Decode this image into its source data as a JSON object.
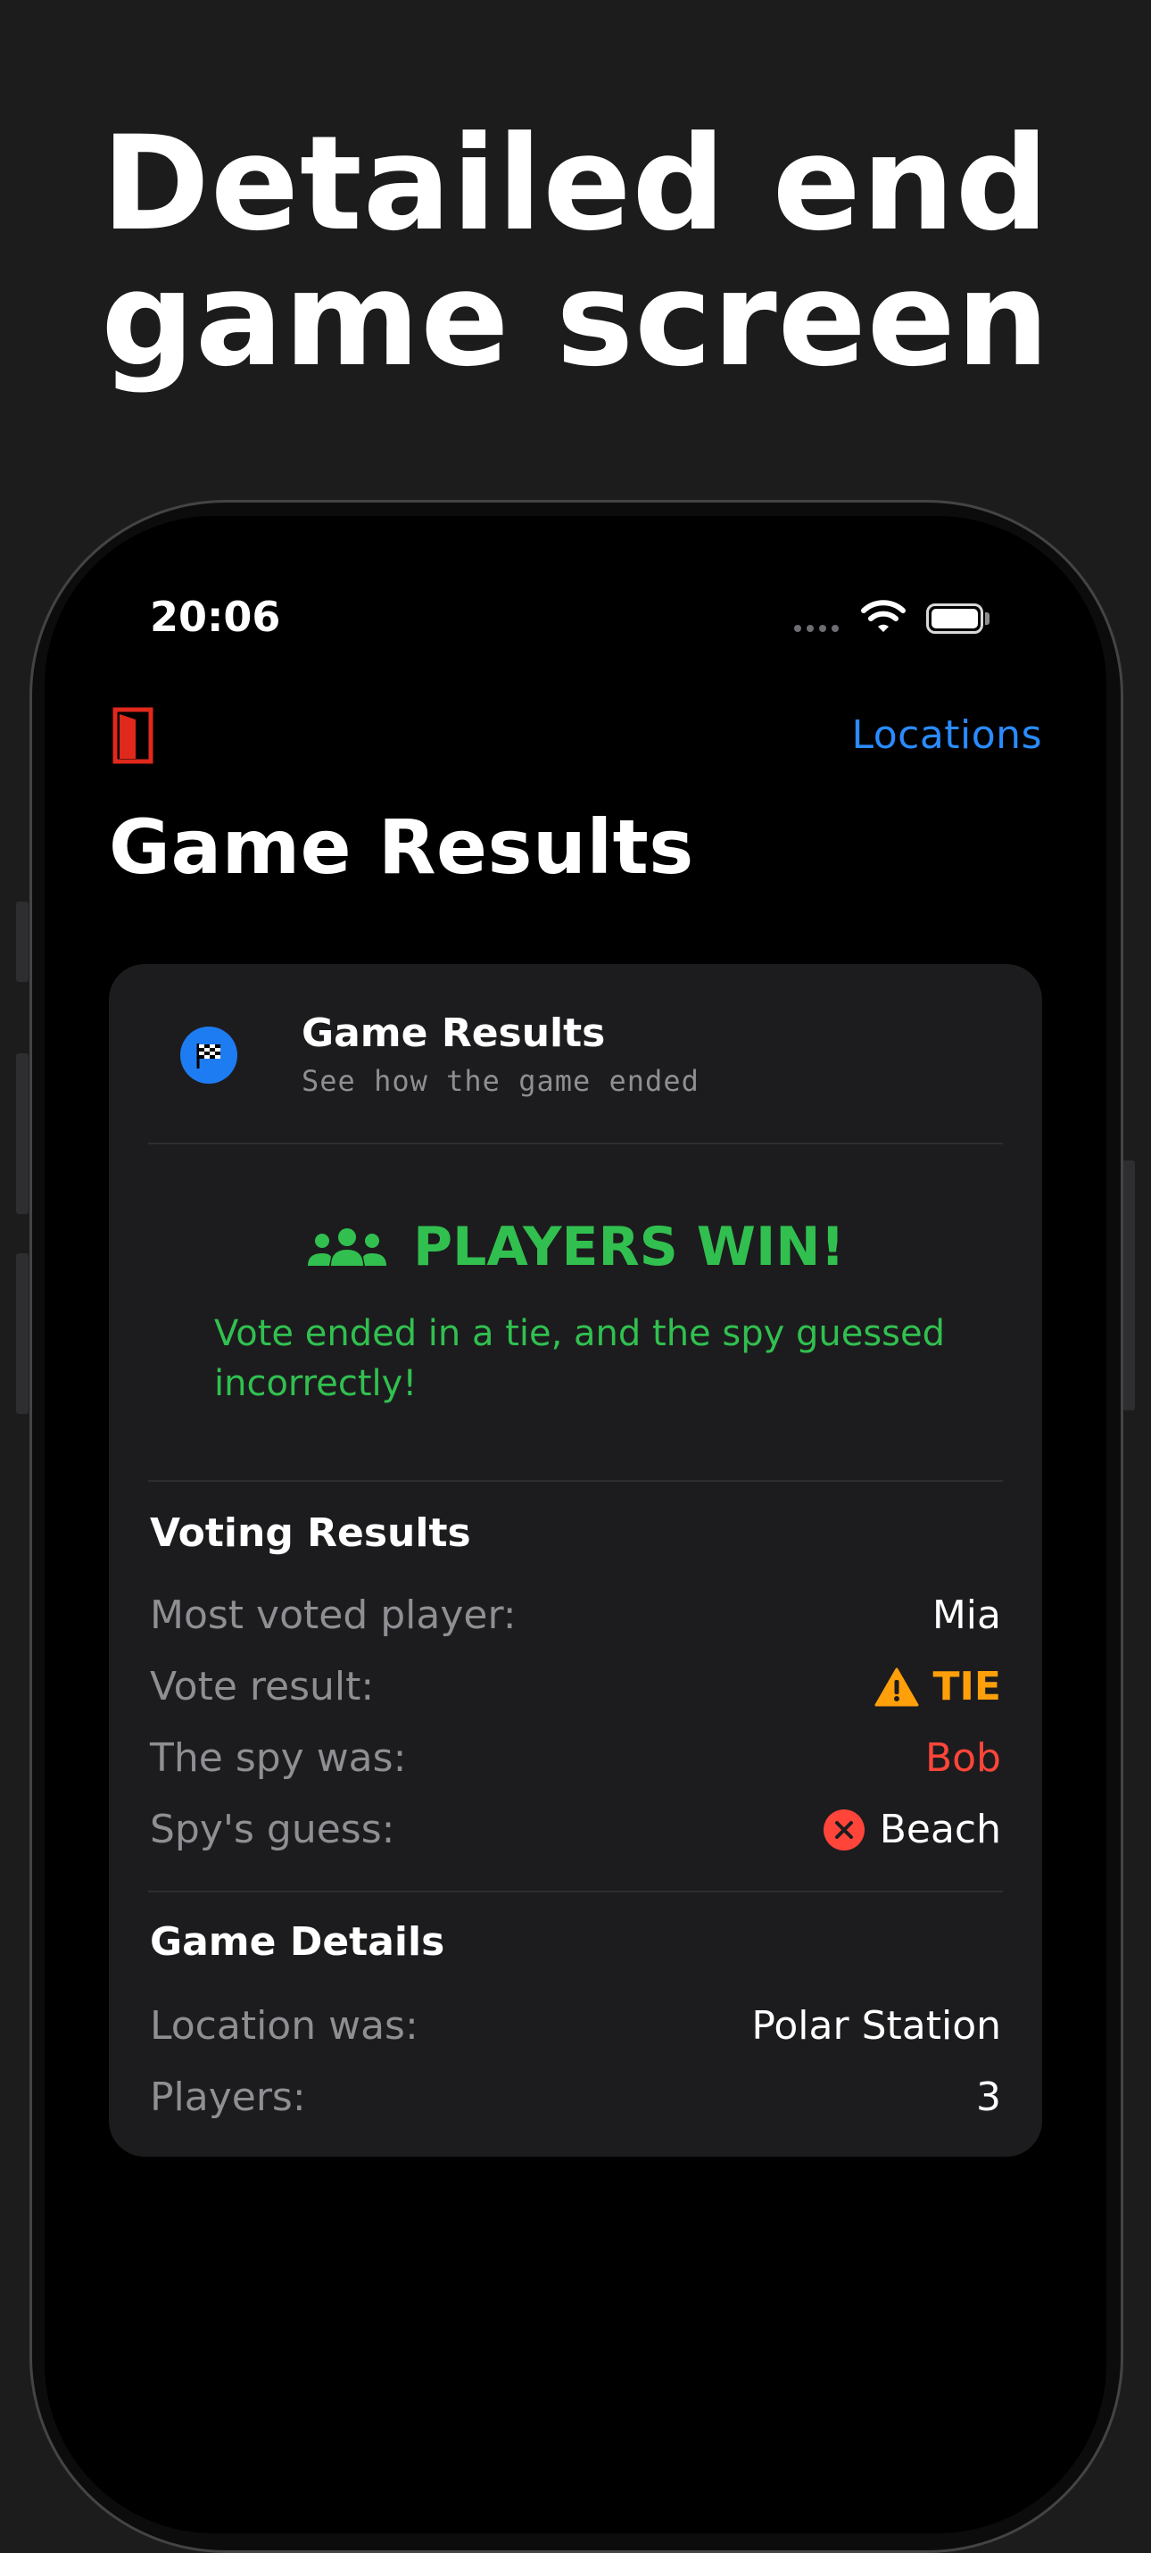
{
  "headline": {
    "line1": "Detailed end",
    "line2": "game screen"
  },
  "status_bar": {
    "time": "20:06"
  },
  "nav": {
    "locations_label": "Locations",
    "large_title": "Game Results"
  },
  "card": {
    "title": "Game Results",
    "subtitle": "See how the game ended",
    "result": {
      "title": "PLAYERS WIN!",
      "description": "Vote ended in a tie, and the spy guessed incorrectly!"
    },
    "voting_results": {
      "title": "Voting Results",
      "rows": [
        {
          "label": "Most voted player:",
          "value": "Mia"
        },
        {
          "label": "Vote result:",
          "value": "TIE",
          "icon": "warning-icon"
        },
        {
          "label": "The spy was:",
          "value": "Bob"
        },
        {
          "label": "Spy's guess:",
          "value": "Beach",
          "icon": "xmark-circle-icon"
        }
      ]
    },
    "game_details": {
      "title": "Game Details",
      "rows": [
        {
          "label": "Location was:",
          "value": "Polar Station"
        },
        {
          "label": "Players:",
          "value": "3"
        }
      ]
    }
  },
  "colors": {
    "accent_blue": "#2a8bff",
    "win_green": "#31c04f",
    "tie_orange": "#ff9f0a",
    "spy_red": "#ff453a"
  }
}
